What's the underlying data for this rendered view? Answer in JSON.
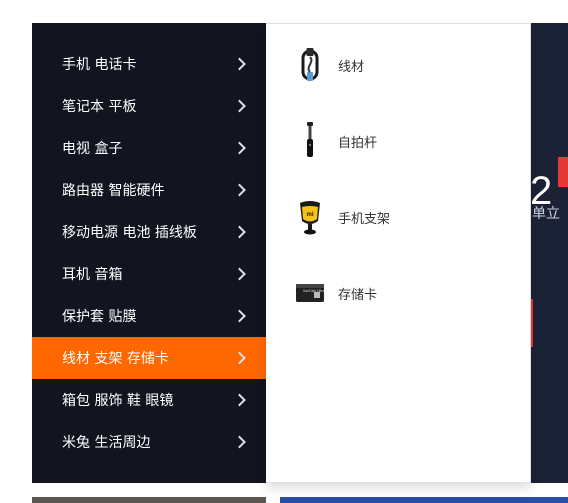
{
  "banner": {
    "number": "2",
    "subtitle": "单立"
  },
  "menu": {
    "items": [
      {
        "label": "手机 电话卡"
      },
      {
        "label": "笔记本 平板"
      },
      {
        "label": "电视 盒子"
      },
      {
        "label": "路由器 智能硬件"
      },
      {
        "label": "移动电源 电池 插线板"
      },
      {
        "label": "耳机 音箱"
      },
      {
        "label": "保护套 贴膜"
      },
      {
        "label": "线材 支架 存储卡"
      },
      {
        "label": "箱包 服饰 鞋 眼镜"
      },
      {
        "label": "米兔 生活周边"
      }
    ],
    "active_index": 7,
    "active_color": "#ff6700",
    "background_color": "#121420"
  },
  "flyout": {
    "items": [
      {
        "label": "线材",
        "icon": "cable-icon"
      },
      {
        "label": "自拍杆",
        "icon": "selfie-stick-icon"
      },
      {
        "label": "手机支架",
        "icon": "phone-holder-icon"
      },
      {
        "label": "存储卡",
        "icon": "memory-card-icon"
      }
    ],
    "card_text": "SanDisk Ultra"
  }
}
